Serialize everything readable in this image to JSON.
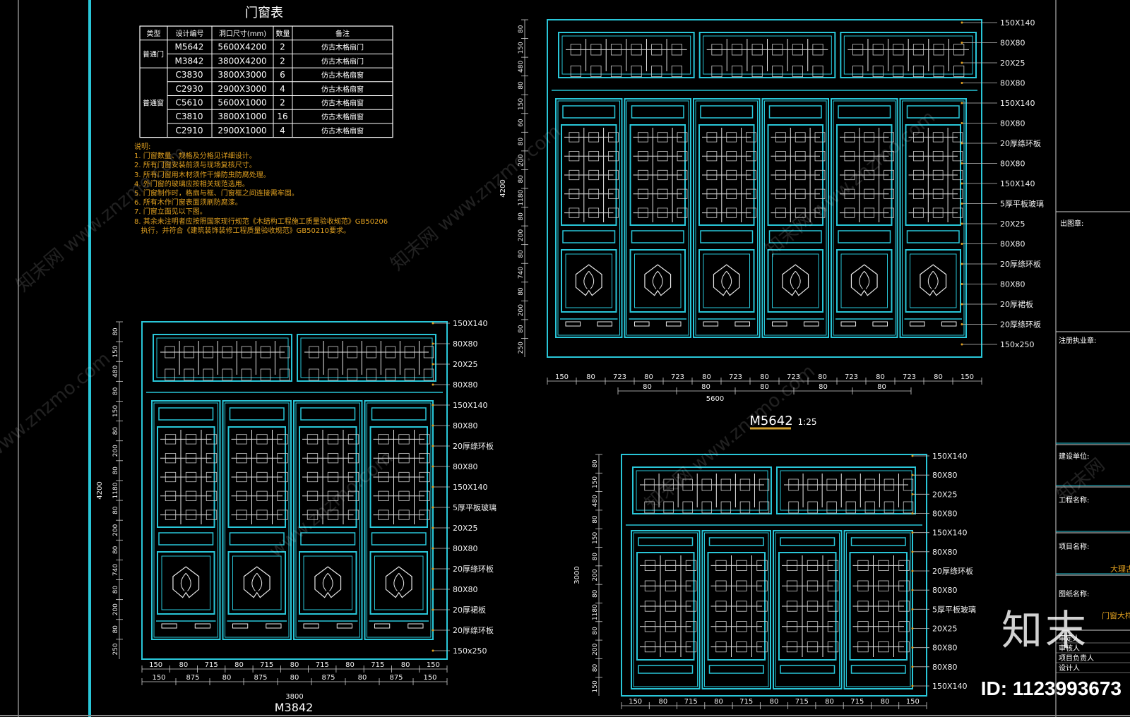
{
  "colors": {
    "bg": "#000000",
    "frame": "#29c6d8",
    "line": "#ffffff",
    "dim": "#f0f0f0",
    "note": "#e0a020",
    "title_underline": "#d0a030"
  },
  "table": {
    "title": "门窗表",
    "headers": [
      "类型",
      "设计编号",
      "洞口尺寸(mm)",
      "数量",
      "备注"
    ],
    "group_door": "普通门",
    "group_window": "普通窗",
    "rows": [
      {
        "code": "M5642",
        "size": "5600X4200",
        "qty": "2",
        "note": "仿古木格扇门"
      },
      {
        "code": "M3842",
        "size": "3800X4200",
        "qty": "2",
        "note": "仿古木格扇门"
      },
      {
        "code": "C3830",
        "size": "3800X3000",
        "qty": "6",
        "note": "仿古木格扇窗"
      },
      {
        "code": "C2930",
        "size": "2900X3000",
        "qty": "4",
        "note": "仿古木格扇窗"
      },
      {
        "code": "C5610",
        "size": "5600X1000",
        "qty": "2",
        "note": "仿古木格扇窗"
      },
      {
        "code": "C3810",
        "size": "3800X1000",
        "qty": "16",
        "note": "仿古木格扇窗"
      },
      {
        "code": "C2910",
        "size": "2900X1000",
        "qty": "4",
        "note": "仿古木格扇窗"
      }
    ]
  },
  "notes": [
    "说明:",
    "1. 门窗数量、规格及分格见详细设计。",
    "2. 所有门窗安装前须与现场复核尺寸。",
    "3. 所有门窗用木材须作干燥防虫防腐处理。",
    "4. 外门窗的玻璃应按相关规范选用。",
    "5. 门窗制作时，格扇与框、门窗框之间连接需牢固。",
    "6. 所有木作门窗表面须刷防腐漆。",
    "7. 门窗立面见以下图。",
    "8. 其余未注明者应按照国家现行规范《木结构工程施工质量验收规范》GB50206",
    "   执行，并符合《建筑装饰装修工程质量验收规范》GB50210要求。"
  ],
  "drawings": {
    "m5642": {
      "label": "M5642",
      "scale": "1:25",
      "overall_width": "5600",
      "overall_height": "4200",
      "bottom_dims": [
        "150",
        "80",
        "723",
        "80",
        "723",
        "80",
        "723",
        "80",
        "723",
        "80",
        "723",
        "80",
        "723",
        "80",
        "150"
      ],
      "sub_dims": [
        "80",
        "80",
        "80",
        "80",
        "80"
      ],
      "left_dims": [
        "80",
        "150",
        "480",
        "80",
        "150",
        "60",
        "80",
        "200",
        "80",
        "1180",
        "80",
        "200",
        "80",
        "740",
        "80",
        "200",
        "80",
        "250"
      ],
      "callouts": [
        "150X140",
        "80X80",
        "20X25",
        "80X80",
        "150X140",
        "80X80",
        "20厚绦环板",
        "80X80",
        "150X140",
        "5厚平板玻璃",
        "20X25",
        "80X80",
        "20厚绦环板",
        "80X80",
        "20厚裙板",
        "20厚绦环板",
        "150x250"
      ]
    },
    "m3842": {
      "label": "M3842",
      "scale": "1:25",
      "overall_width": "3800",
      "overall_height": "4200",
      "bottom_dims_a": [
        "150",
        "80",
        "715",
        "80",
        "715",
        "80",
        "715",
        "80",
        "715",
        "80",
        "150"
      ],
      "bottom_dims_b": [
        "150",
        "875",
        "80",
        "875",
        "80",
        "875",
        "80",
        "875",
        "150"
      ],
      "left_dims": [
        "80",
        "150",
        "480",
        "80",
        "150",
        "80",
        "200",
        "80",
        "1180",
        "80",
        "200",
        "80",
        "740",
        "80",
        "200",
        "80",
        "250"
      ],
      "callouts": [
        "150X140",
        "80X80",
        "20X25",
        "80X80",
        "150X140",
        "80X80",
        "20厚绦环板",
        "80X80",
        "150X140",
        "5厚平板玻璃",
        "20X25",
        "80X80",
        "20厚绦环板",
        "80X80",
        "20厚裙板",
        "20厚绦环板",
        "150x250"
      ]
    },
    "c3830": {
      "overall_height": "3000",
      "bottom_dims": [
        "150",
        "80",
        "715",
        "80",
        "715",
        "80",
        "715",
        "80",
        "715",
        "80",
        "150"
      ],
      "left_dims": [
        "80",
        "150",
        "480",
        "80",
        "150",
        "80",
        "200",
        "80",
        "1180",
        "80",
        "200",
        "80",
        "150"
      ],
      "callouts": [
        "150X140",
        "80X80",
        "20X25",
        "80X80",
        "150X140",
        "80X80",
        "20厚绦环板",
        "80X80",
        "5厚平板玻璃",
        "20X25",
        "80X80",
        "80X80",
        "150X140"
      ]
    }
  },
  "title_block": {
    "stamp": "出图章:",
    "reg_stamp": "注册执业章:",
    "client": "建设单位:",
    "project": "工程名称:",
    "item": "项目名称:",
    "item_value": "大理古",
    "drawing": "图纸名称:",
    "drawing_value": "门窗大样",
    "roles": [
      "审定人",
      "审核人",
      "项目负责人",
      "设计人"
    ]
  },
  "watermarks": [
    "知末网 www.znzmo.com",
    "知末网 www.znzmo.com",
    "知末网 www.znzmo.com",
    "知末网 www.znzmo.com",
    "www.znzmo.com",
    "www.znzmo.com",
    "知末网"
  ],
  "brand": {
    "logo": "知末",
    "id": "ID: 1123993673"
  }
}
